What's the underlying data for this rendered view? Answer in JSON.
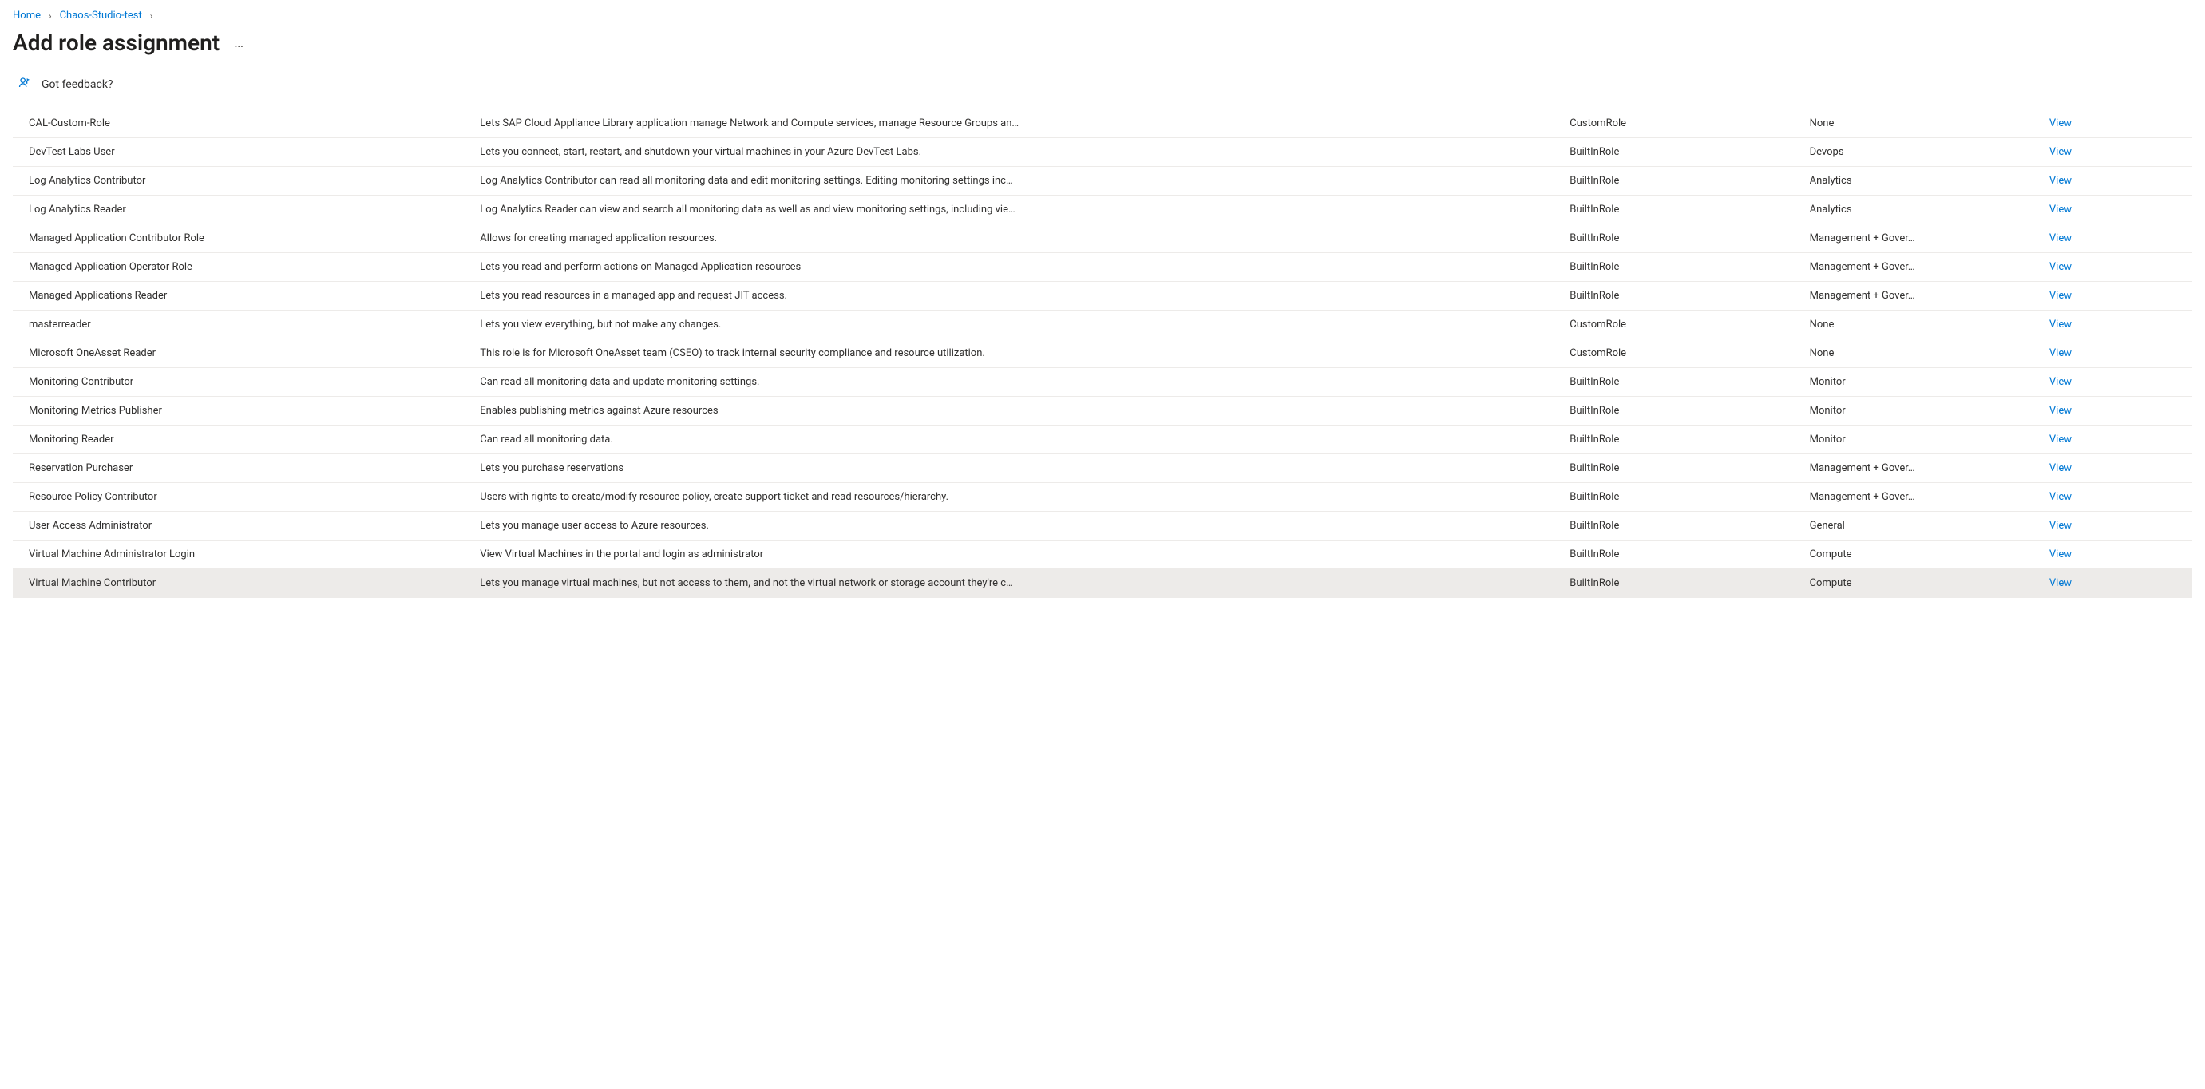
{
  "breadcrumb": {
    "home": "Home",
    "second": "Chaos-Studio-test"
  },
  "page_title": "Add role assignment",
  "feedback_label": "Got feedback?",
  "table": {
    "view_label": "View",
    "rows": [
      {
        "name": "CAL-Custom-Role",
        "desc": "Lets SAP Cloud Appliance Library application manage Network and Compute services, manage Resource Groups an…",
        "type": "CustomRole",
        "category": "None"
      },
      {
        "name": "DevTest Labs User",
        "desc": "Lets you connect, start, restart, and shutdown your virtual machines in your Azure DevTest Labs.",
        "type": "BuiltInRole",
        "category": "Devops"
      },
      {
        "name": "Log Analytics Contributor",
        "desc": "Log Analytics Contributor can read all monitoring data and edit monitoring settings. Editing monitoring settings inc…",
        "type": "BuiltInRole",
        "category": "Analytics"
      },
      {
        "name": "Log Analytics Reader",
        "desc": "Log Analytics Reader can view and search all monitoring data as well as and view monitoring settings, including vie…",
        "type": "BuiltInRole",
        "category": "Analytics"
      },
      {
        "name": "Managed Application Contributor Role",
        "desc": "Allows for creating managed application resources.",
        "type": "BuiltInRole",
        "category": "Management + Gover…"
      },
      {
        "name": "Managed Application Operator Role",
        "desc": "Lets you read and perform actions on Managed Application resources",
        "type": "BuiltInRole",
        "category": "Management + Gover…"
      },
      {
        "name": "Managed Applications Reader",
        "desc": "Lets you read resources in a managed app and request JIT access.",
        "type": "BuiltInRole",
        "category": "Management + Gover…"
      },
      {
        "name": "masterreader",
        "desc": "Lets you view everything, but not make any changes.",
        "type": "CustomRole",
        "category": "None"
      },
      {
        "name": "Microsoft OneAsset Reader",
        "desc": "This role is for Microsoft OneAsset team (CSEO) to track internal security compliance and resource utilization.",
        "type": "CustomRole",
        "category": "None"
      },
      {
        "name": "Monitoring Contributor",
        "desc": "Can read all monitoring data and update monitoring settings.",
        "type": "BuiltInRole",
        "category": "Monitor"
      },
      {
        "name": "Monitoring Metrics Publisher",
        "desc": "Enables publishing metrics against Azure resources",
        "type": "BuiltInRole",
        "category": "Monitor"
      },
      {
        "name": "Monitoring Reader",
        "desc": "Can read all monitoring data.",
        "type": "BuiltInRole",
        "category": "Monitor"
      },
      {
        "name": "Reservation Purchaser",
        "desc": "Lets you purchase reservations",
        "type": "BuiltInRole",
        "category": "Management + Gover…"
      },
      {
        "name": "Resource Policy Contributor",
        "desc": "Users with rights to create/modify resource policy, create support ticket and read resources/hierarchy.",
        "type": "BuiltInRole",
        "category": "Management + Gover…"
      },
      {
        "name": "User Access Administrator",
        "desc": "Lets you manage user access to Azure resources.",
        "type": "BuiltInRole",
        "category": "General"
      },
      {
        "name": "Virtual Machine Administrator Login",
        "desc": "View Virtual Machines in the portal and login as administrator",
        "type": "BuiltInRole",
        "category": "Compute"
      },
      {
        "name": "Virtual Machine Contributor",
        "desc": "Lets you manage virtual machines, but not access to them, and not the virtual network or storage account they're c…",
        "type": "BuiltInRole",
        "category": "Compute",
        "selected": true
      }
    ]
  }
}
